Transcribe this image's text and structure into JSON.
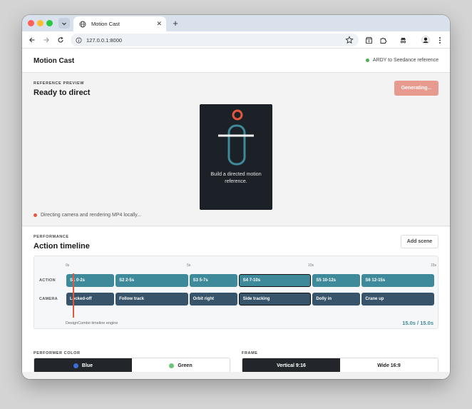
{
  "browser": {
    "tab_title": "Motion Cast",
    "url": "127.0.0.1:8000"
  },
  "app": {
    "title": "Motion Cast",
    "status_text": "ARDY to Seedance reference",
    "status_color": "#4caf50"
  },
  "preview": {
    "eyebrow": "REFERENCE PREVIEW",
    "heading": "Ready to direct",
    "generate_label": "Generating...",
    "caption": "Build a directed motion reference.",
    "render_status": "Directing camera and rendering MP4 locally...",
    "accent_color": "#e2573d"
  },
  "performance": {
    "eyebrow": "PERFORMANCE",
    "heading": "Action timeline",
    "add_scene_label": "Add scene"
  },
  "timeline": {
    "ruler": [
      "0s",
      "5s",
      "10s",
      "15s"
    ],
    "duration_s": 15,
    "playhead_s": 0.3,
    "action_label": "ACTION",
    "camera_label": "CAMERA",
    "action_clips": [
      {
        "label": "S1 0-2s",
        "start": 0,
        "end": 2,
        "selected": false
      },
      {
        "label": "S2 2-5s",
        "start": 2,
        "end": 5,
        "selected": false
      },
      {
        "label": "S3 5-7s",
        "start": 5,
        "end": 7,
        "selected": false
      },
      {
        "label": "S4 7-10s",
        "start": 7,
        "end": 10,
        "selected": true
      },
      {
        "label": "S5 10-12s",
        "start": 10,
        "end": 12,
        "selected": false
      },
      {
        "label": "S6 12-15s",
        "start": 12,
        "end": 15,
        "selected": false
      }
    ],
    "camera_clips": [
      {
        "label": "Locked-off",
        "start": 0,
        "end": 2,
        "selected": false
      },
      {
        "label": "Follow track",
        "start": 2,
        "end": 5,
        "selected": false
      },
      {
        "label": "Orbit right",
        "start": 5,
        "end": 7,
        "selected": false
      },
      {
        "label": "Side tracking",
        "start": 7,
        "end": 10,
        "selected": true
      },
      {
        "label": "Dolly in",
        "start": 10,
        "end": 12,
        "selected": false
      },
      {
        "label": "Crane up",
        "start": 12,
        "end": 15,
        "selected": false
      }
    ],
    "engine_label": "DesignCombo timeline engine",
    "time_readout": "15.0s / 15.0s"
  },
  "performer_color": {
    "label": "PERFORMER COLOR",
    "options": [
      {
        "label": "Blue",
        "color": "#3b6fd6",
        "active": true
      },
      {
        "label": "Green",
        "color": "#6cc47a",
        "active": false
      }
    ]
  },
  "frame": {
    "label": "FRAME",
    "options": [
      {
        "label": "Vertical 9:16",
        "active": true
      },
      {
        "label": "Wide 16:9",
        "active": false
      }
    ]
  }
}
